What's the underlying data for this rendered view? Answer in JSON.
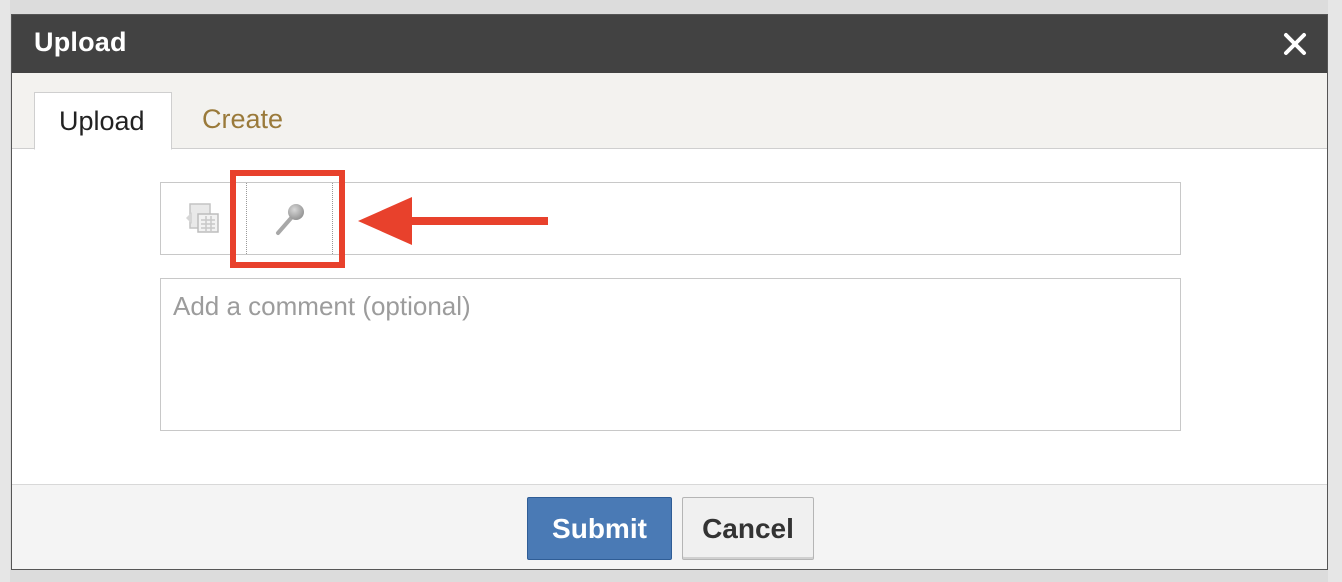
{
  "dialog": {
    "title": "Upload",
    "close_glyph": "✕"
  },
  "tabs": [
    {
      "label": "Upload",
      "active": true
    },
    {
      "label": "Create",
      "active": false
    }
  ],
  "toolbar": {
    "tools": [
      {
        "icon": "document-upload-icon"
      },
      {
        "icon": "microphone-icon"
      }
    ]
  },
  "comment": {
    "value": "",
    "placeholder": "Add a comment (optional)"
  },
  "footer": {
    "submit_label": "Submit",
    "cancel_label": "Cancel"
  },
  "colors": {
    "titlebar": "#424242",
    "submit": "#4a7ab5",
    "create_tab_text": "#9a7a3a",
    "annotation": "#e8412c"
  }
}
